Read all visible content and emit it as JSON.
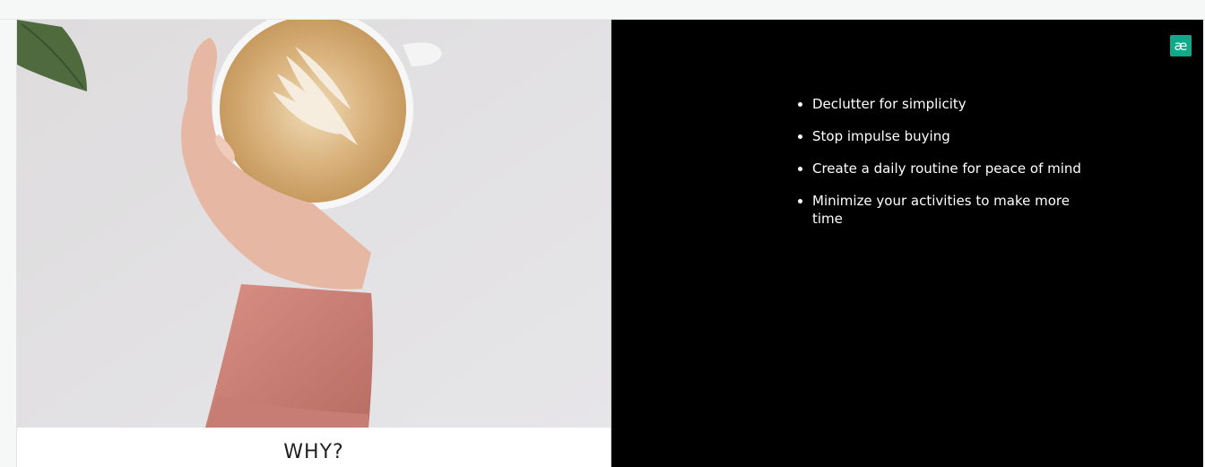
{
  "slide": {
    "caption": "WHY?",
    "logo_text": "æ",
    "bullets": [
      "Declutter for simplicity",
      "Stop impulse buying",
      "Create a daily routine for peace of mind",
      "Minimize your activities to make more time"
    ]
  },
  "colors": {
    "panel_background": "#000000",
    "bullet_text": "#ffffff",
    "logo_background": "#12a88a"
  }
}
